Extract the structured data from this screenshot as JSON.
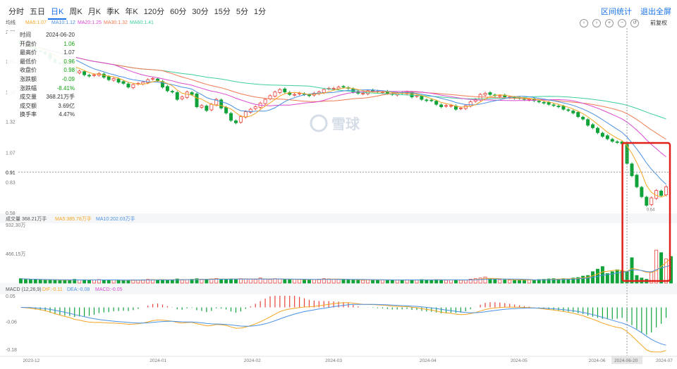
{
  "tabs": [
    {
      "label": "分时",
      "active": false
    },
    {
      "label": "五日",
      "active": false
    },
    {
      "label": "日K",
      "active": true
    },
    {
      "label": "周K",
      "active": false
    },
    {
      "label": "月K",
      "active": false
    },
    {
      "label": "季K",
      "active": false
    },
    {
      "label": "年K",
      "active": false
    },
    {
      "label": "120分",
      "active": false
    },
    {
      "label": "60分",
      "active": false
    },
    {
      "label": "30分",
      "active": false
    },
    {
      "label": "15分",
      "active": false
    },
    {
      "label": "5分",
      "active": false
    },
    {
      "label": "1分",
      "active": false
    }
  ],
  "actions": {
    "stats": "区间统计",
    "fullscreen": "退出全屏"
  },
  "fuquan": "前复权",
  "watermark": "雪球",
  "colors": {
    "up": "#e8413b",
    "down": "#11a33a",
    "ma5": "#f5a623",
    "ma10": "#4a90e2",
    "ma20": "#d94ad0",
    "ma30": "#ef7a52",
    "ma60": "#3ecf9c",
    "highlight": "#e0201b",
    "accent": "#1a73e8"
  },
  "price_legend": {
    "label": "均线",
    "ma5": "MA5:1.07",
    "ma10": "MA10:1.12",
    "ma20": "MA20:1.25",
    "ma30": "MA30:1.32",
    "ma60": "MA60:1.41"
  },
  "vol_legend": {
    "label": "成交量 368.21万手",
    "ma5": "MA5:385.78万手",
    "ma10": "MA10:202.03万手"
  },
  "macd_legend": {
    "label": "MACD (12,26,9)",
    "dif": "DIF:-0.11",
    "dea": "DEA:-0.08",
    "macd": "MACD:-0.05"
  },
  "tooltip": [
    {
      "k": "时间",
      "v": "2024-06-20",
      "c": ""
    },
    {
      "k": "开盘价",
      "v": "1.06",
      "c": "green"
    },
    {
      "k": "最高价",
      "v": "1.07",
      "c": ""
    },
    {
      "k": "最低价",
      "v": "0.96",
      "c": "green"
    },
    {
      "k": "收盘价",
      "v": "0.98",
      "c": "green"
    },
    {
      "k": "涨跌额",
      "v": "-0.09",
      "c": "green"
    },
    {
      "k": "涨跌幅",
      "v": "-8.41%",
      "c": "green"
    },
    {
      "k": "成交量",
      "v": "368.21万手",
      "c": ""
    },
    {
      "k": "成交额",
      "v": "3.69亿",
      "c": ""
    },
    {
      "k": "换手率",
      "v": "4.47%",
      "c": ""
    }
  ],
  "chart_data": {
    "type": "candlestick",
    "price_ticks": [
      "2.05",
      "1.81",
      "1.56",
      "1.32",
      "1.07",
      "0.91",
      "0.83",
      "0.58"
    ],
    "price_ylim": [
      0.58,
      2.05
    ],
    "crosshair_price": "0.91",
    "low_label": "0.64",
    "vol_ticks": [
      "932.30万",
      "466.15万"
    ],
    "vol_ylim": [
      0,
      932.3
    ],
    "macd_ticks": [
      "0.05",
      "-0.06",
      "-0.18"
    ],
    "macd_ylim": [
      -0.18,
      0.05
    ],
    "date_ticks": [
      "2023-12",
      "2024-01",
      "2024-02",
      "2024-03",
      "2024-04",
      "2024-05",
      "2024-06",
      "2024-06-20",
      "2024-07"
    ],
    "date_tick_pos": [
      0.02,
      0.215,
      0.36,
      0.485,
      0.63,
      0.77,
      0.89,
      0.958,
      1.0
    ],
    "highlight_from_index": 124,
    "crosshair_index": 124,
    "close": [
      1.95,
      1.93,
      1.92,
      1.9,
      1.89,
      1.87,
      1.83,
      1.8,
      1.79,
      1.77,
      1.76,
      1.71,
      1.73,
      1.7,
      1.69,
      1.7,
      1.71,
      1.68,
      1.66,
      1.67,
      1.64,
      1.63,
      1.6,
      1.62,
      1.63,
      1.64,
      1.66,
      1.67,
      1.65,
      1.6,
      1.57,
      1.56,
      1.5,
      1.52,
      1.56,
      1.54,
      1.44,
      1.45,
      1.41,
      1.46,
      1.5,
      1.43,
      1.39,
      1.33,
      1.31,
      1.36,
      1.4,
      1.42,
      1.44,
      1.47,
      1.5,
      1.53,
      1.56,
      1.58,
      1.56,
      1.54,
      1.54,
      1.55,
      1.54,
      1.53,
      1.55,
      1.56,
      1.58,
      1.59,
      1.59,
      1.6,
      1.6,
      1.59,
      1.56,
      1.55,
      1.55,
      1.57,
      1.57,
      1.56,
      1.56,
      1.55,
      1.54,
      1.55,
      1.55,
      1.56,
      1.52,
      1.53,
      1.5,
      1.49,
      1.49,
      1.46,
      1.44,
      1.45,
      1.45,
      1.42,
      1.43,
      1.45,
      1.48,
      1.5,
      1.54,
      1.55,
      1.54,
      1.53,
      1.53,
      1.52,
      1.52,
      1.51,
      1.51,
      1.5,
      1.5,
      1.49,
      1.48,
      1.47,
      1.46,
      1.45,
      1.44,
      1.42,
      1.41,
      1.39,
      1.36,
      1.34,
      1.29,
      1.27,
      1.23,
      1.2,
      1.18,
      1.16,
      1.15,
      1.14,
      0.98,
      0.88,
      0.79,
      0.71,
      0.64,
      0.7,
      0.76,
      0.72,
      0.79
    ],
    "volume": [
      70,
      60,
      55,
      58,
      50,
      45,
      52,
      48,
      44,
      46,
      50,
      60,
      48,
      52,
      45,
      50,
      55,
      48,
      46,
      50,
      44,
      42,
      46,
      50,
      48,
      52,
      58,
      54,
      50,
      56,
      48,
      52,
      66,
      50,
      54,
      60,
      70,
      62,
      58,
      66,
      72,
      60,
      58,
      66,
      60,
      70,
      66,
      64,
      58,
      80,
      62,
      58,
      70,
      64,
      56,
      52,
      60,
      58,
      54,
      50,
      56,
      62,
      70,
      66,
      60,
      58,
      56,
      54,
      50,
      48,
      46,
      50,
      54,
      52,
      50,
      48,
      46,
      48,
      50,
      52,
      50,
      48,
      56,
      52,
      50,
      54,
      48,
      46,
      50,
      52,
      46,
      48,
      62,
      70,
      80,
      96,
      66,
      56,
      54,
      50,
      48,
      46,
      52,
      50,
      48,
      46,
      56,
      60,
      66,
      70,
      62,
      70,
      66,
      80,
      88,
      110,
      120,
      180,
      220,
      260,
      150,
      180,
      210,
      190,
      180,
      400,
      120,
      80,
      60,
      180,
      520,
      480,
      380,
      420
    ]
  }
}
